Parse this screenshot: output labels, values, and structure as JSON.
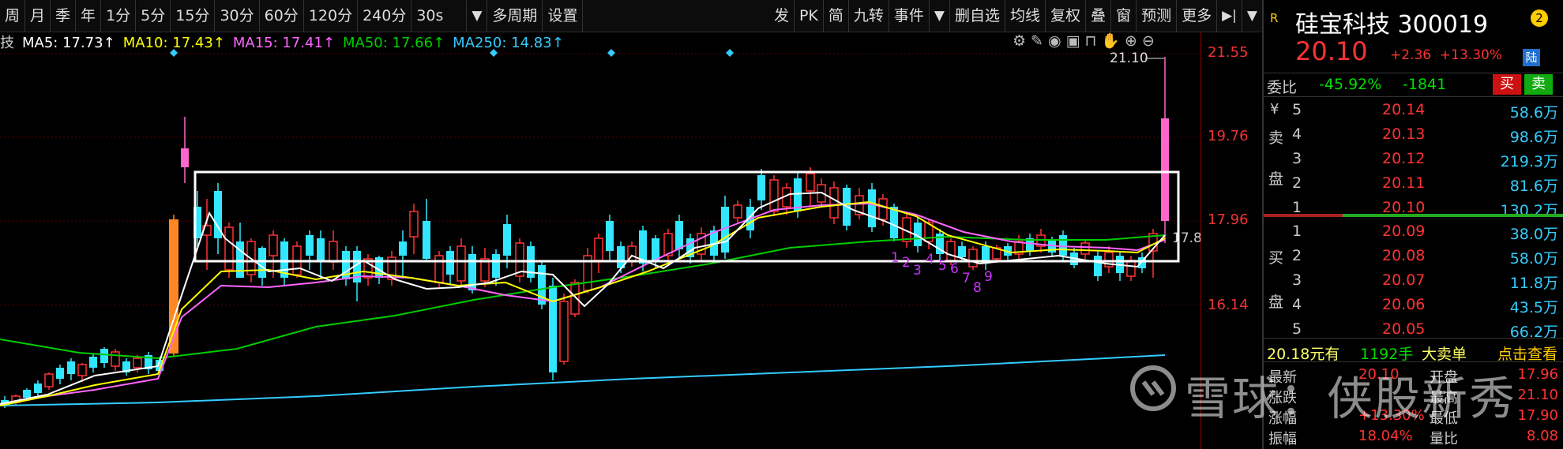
{
  "toolbar": {
    "periods": [
      "周",
      "月",
      "季",
      "年",
      "1分",
      "5分",
      "15分",
      "30分",
      "60分",
      "120分",
      "240分",
      "30s"
    ],
    "more_period": "多周期",
    "settings": "设置",
    "actions": [
      "发",
      "PK",
      "简",
      "九转",
      "事件"
    ],
    "actions2": [
      "删自选",
      "均线",
      "复权",
      "叠",
      "窗",
      "预测",
      "更多"
    ]
  },
  "ma_bar": {
    "prefix": "技",
    "ma5": "MA5: 17.73↑",
    "ma10": "MA10: 17.43↑",
    "ma15": "MA15: 17.41↑",
    "ma50": "MA50: 17.66↑",
    "ma250": "MA250: 14.83↑",
    "colors": {
      "ma5": "#ffffff",
      "ma10": "#ffff00",
      "ma15": "#ff66ff",
      "ma50": "#00cc00",
      "ma250": "#33ccff"
    }
  },
  "price_axis": [
    "21.55",
    "19.76",
    "17.96",
    "16.14"
  ],
  "price_axis_current": "17.8",
  "chart_annotations": {
    "high_label": "21.10",
    "counts": [
      "1",
      "2",
      "3",
      "4",
      "5",
      "6",
      "7",
      "8",
      "9"
    ]
  },
  "quote": {
    "flag": "R",
    "name": "硅宝科技",
    "code": "300019",
    "badge": "2",
    "price": "20.10",
    "change": "+2.36",
    "change_pct": "+13.30%",
    "lu": "陆"
  },
  "weibi": {
    "label": "委比",
    "pct": "-45.92%",
    "diff": "-1841",
    "buy": "买",
    "sell": "卖"
  },
  "sell_side": {
    "currency": "¥",
    "labels": [
      "卖",
      "盘"
    ],
    "rows": [
      {
        "lvl": "5",
        "price": "20.14",
        "vol": "58.6万"
      },
      {
        "lvl": "4",
        "price": "20.13",
        "vol": "98.6万"
      },
      {
        "lvl": "3",
        "price": "20.12",
        "vol": "219.3万"
      },
      {
        "lvl": "2",
        "price": "20.11",
        "vol": "81.6万"
      },
      {
        "lvl": "1",
        "price": "20.10",
        "vol": "130.2万"
      }
    ]
  },
  "buy_side": {
    "labels": [
      "买",
      "盘"
    ],
    "rows": [
      {
        "lvl": "1",
        "price": "20.09",
        "vol": "38.0万"
      },
      {
        "lvl": "2",
        "price": "20.08",
        "vol": "58.0万"
      },
      {
        "lvl": "3",
        "price": "20.07",
        "vol": "11.8万"
      },
      {
        "lvl": "4",
        "price": "20.06",
        "vol": "43.5万"
      },
      {
        "lvl": "5",
        "price": "20.05",
        "vol": "66.2万"
      }
    ]
  },
  "big_order": {
    "price": "20.18元有",
    "qty": "1192手",
    "label": "大卖单",
    "action": "点击查看"
  },
  "stats": [
    {
      "l1": "最新",
      "v1": "20.10",
      "l2": "开盘",
      "v2": "17.96"
    },
    {
      "l1": "涨跌",
      "v1": "",
      "l2": "最高",
      "v2": "21.10"
    },
    {
      "l1": "涨幅",
      "v1": "+13.30%",
      "l2": "最低",
      "v2": "17.90"
    },
    {
      "l1": "振幅",
      "v1": "18.04%",
      "l2": "量比",
      "v2": "8.08"
    }
  ],
  "watermark": "雪球：侠股新秀"
}
